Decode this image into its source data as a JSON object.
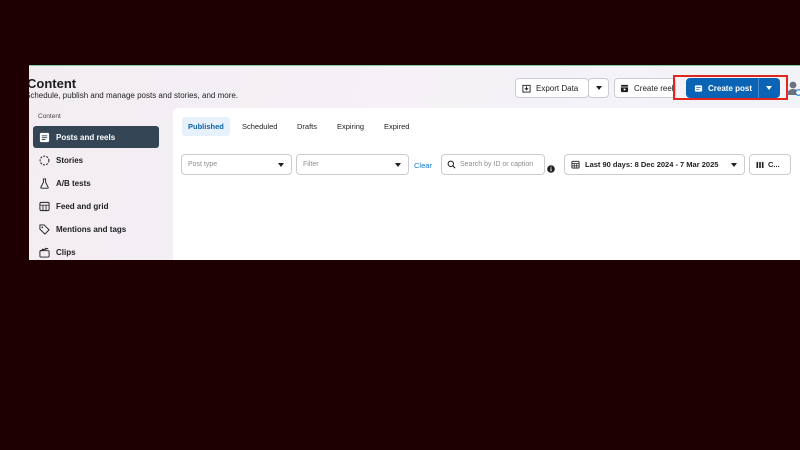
{
  "header": {
    "title": "Content",
    "subtitle": "Schedule, publish and manage posts and stories, and more."
  },
  "toolbar": {
    "export_label": "Export Data",
    "create_reel_label": "Create reel",
    "create_post_label": "Create post"
  },
  "sidebar": {
    "section_label": "Content",
    "items": [
      {
        "label": "Posts and reels",
        "icon": "posts-icon",
        "active": true
      },
      {
        "label": "Stories",
        "icon": "stories-icon"
      },
      {
        "label": "A/B tests",
        "icon": "flask-icon"
      },
      {
        "label": "Feed and grid",
        "icon": "grid-icon"
      },
      {
        "label": "Mentions and tags",
        "icon": "tag-icon"
      },
      {
        "label": "Clips",
        "icon": "clapper-icon"
      }
    ]
  },
  "tabs": [
    {
      "label": "Published",
      "active": true
    },
    {
      "label": "Scheduled"
    },
    {
      "label": "Drafts"
    },
    {
      "label": "Expiring"
    },
    {
      "label": "Expired"
    }
  ],
  "filters": {
    "post_type_placeholder": "Post type",
    "filter_placeholder": "Filter",
    "clear_label": "Clear",
    "search_placeholder": "Search by ID or caption",
    "date_range": "Last 90 days: 8 Dec 2024 - 7 Mar 2025",
    "columns_label": "C..."
  },
  "colors": {
    "accent": "#0a78d0",
    "primary_button": "#0b63b6",
    "sidebar_active": "#344556",
    "highlight_box": "#e0261e",
    "page_background": "#1e0003"
  }
}
